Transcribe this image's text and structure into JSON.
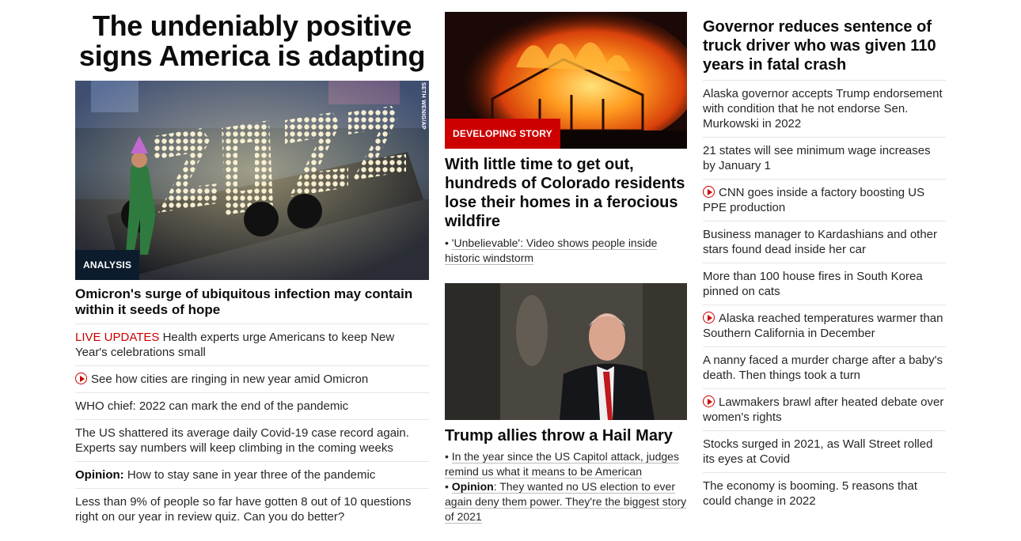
{
  "column_left": {
    "headline": "The undeniably positive signs America is adapting",
    "image_label": "ANALYSIS",
    "photo_credit": "SETH WENIG/AP",
    "image_text": "2022",
    "subheadline": "Omicron's surge of ubiquitous infection may contain within it seeds of hope",
    "items": [
      {
        "prefix": "LIVE UPDATES",
        "text": " Health experts urge Americans to keep New Year's celebrations small"
      },
      {
        "video": true,
        "text": "See how cities are ringing in new year amid Omicron"
      },
      {
        "text": "WHO chief: 2022 can mark the end of the pandemic"
      },
      {
        "text": "The US shattered its average daily Covid-19 case record again. Experts say numbers will keep climbing in the coming weeks"
      },
      {
        "prefix_bold": "Opinion:",
        "text": " How to stay sane in year three of the pandemic"
      },
      {
        "text": "Less than 9% of people so far have gotten 8 out of 10 questions right on our year in review quiz. Can you do better?"
      }
    ]
  },
  "column_middle": {
    "story1": {
      "image_label": "DEVELOPING STORY",
      "headline": "With little time to get out, hundreds of Colorado residents lose their homes in a ferocious wildfire",
      "bullets": [
        {
          "text": "'Unbelievable': Video shows people inside historic windstorm"
        }
      ]
    },
    "story2": {
      "headline": "Trump allies throw a Hail Mary",
      "bullet1": "In the year since the US Capitol attack, judges remind us what it means to be American",
      "bullet2_bold": "Opinion",
      "bullet2_text": ": They wanted no US election to ever again deny them power. They're the biggest story of 2021"
    }
  },
  "column_right": {
    "headline": "Governor reduces sentence of truck driver who was given 110 years in fatal crash",
    "items": [
      {
        "text": "Alaska governor accepts Trump endorsement with condition that he not endorse Sen. Murkowski in 2022"
      },
      {
        "text": "21 states will see minimum wage increases by January 1"
      },
      {
        "video": true,
        "text": "CNN goes inside a factory boosting US PPE production"
      },
      {
        "text": "Business manager to Kardashians and other stars found dead inside her car"
      },
      {
        "text": "More than 100 house fires in South Korea pinned on cats"
      },
      {
        "video": true,
        "text": "Alaska reached temperatures warmer than Southern California in December"
      },
      {
        "text": "A nanny faced a murder charge after a baby's death. Then things took a turn"
      },
      {
        "video": true,
        "text": "Lawmakers brawl after heated debate over women's rights"
      },
      {
        "text": "Stocks surged in 2021, as Wall Street rolled its eyes at Covid"
      },
      {
        "text": "The economy is booming. 5 reasons that could change in 2022"
      }
    ]
  },
  "colors": {
    "accent_red": "#cc0000",
    "label_dark": "#0c1c2c",
    "divider": "#e6e6e6"
  }
}
